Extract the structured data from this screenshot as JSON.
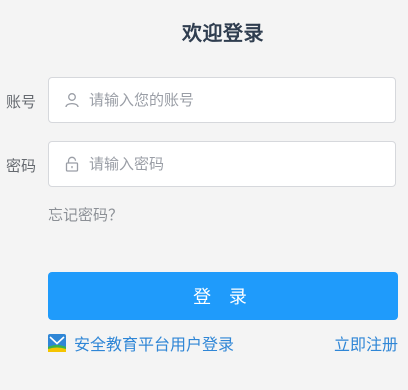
{
  "header": {
    "title": "欢迎登录"
  },
  "form": {
    "account": {
      "label": "账号",
      "placeholder": "请输入您的账号",
      "value": "",
      "icon": "user-icon"
    },
    "password": {
      "label": "密码",
      "placeholder": "请输入密码",
      "value": "",
      "icon": "lock-icon"
    },
    "forgot_label": "忘记密码？",
    "submit_label": "登 录"
  },
  "footer": {
    "alt_login_label": "安全教育平台用户登录",
    "alt_login_icon": "platform-logo-icon",
    "register_label": "立即注册"
  },
  "colors": {
    "accent": "#1f9bfb",
    "link": "#2f86d6",
    "title": "#2f3d4f",
    "background": "#f4f4f4"
  }
}
